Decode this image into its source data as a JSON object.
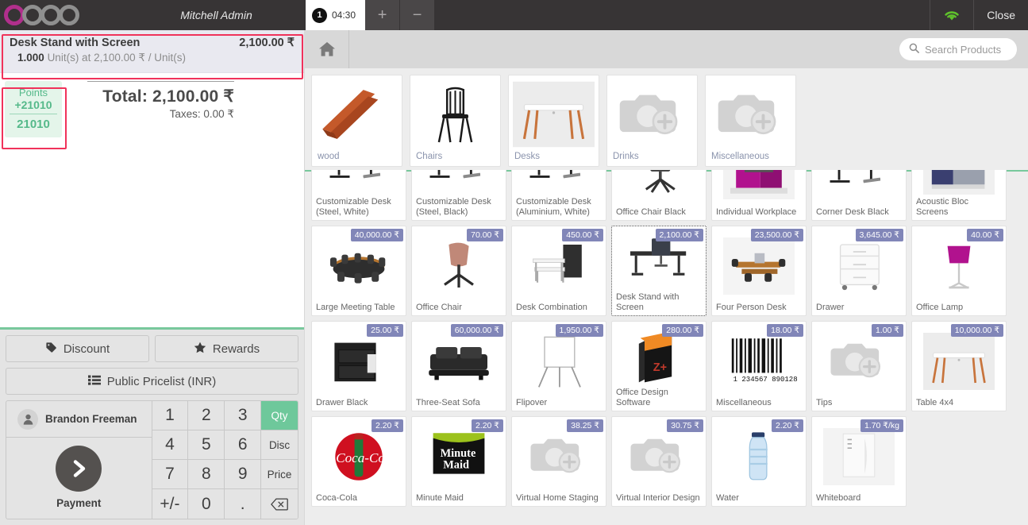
{
  "topbar": {
    "brand": "odoo",
    "user": "Mitchell Admin",
    "order_tab": {
      "sequence": "1",
      "time": "04:30"
    },
    "new_order_label": "+",
    "remove_order_label": "−",
    "wifi_icon": "wifi-icon",
    "close_label": "Close",
    "accent_green": "#7ac143",
    "bar_bg": "#373435"
  },
  "order": {
    "lines": [
      {
        "name": "Desk Stand with Screen",
        "price": "2,100.00 ₹",
        "qty": "1.000",
        "unit_text": "Unit(s) at 2,100.00 ₹ / Unit(s)"
      }
    ],
    "loyalty": {
      "label": "Points",
      "delta": "+21010",
      "total": "21010",
      "color": "#55b98a"
    },
    "total_label": "Total: 2,100.00 ₹",
    "taxes_label": "Taxes: 0.00 ₹"
  },
  "controls": {
    "discount_label": "Discount",
    "rewards_label": "Rewards",
    "pricelist_label": "Public Pricelist (INR)",
    "customer_label": "Brandon Freeman",
    "payment_label": "Payment",
    "numpad": [
      {
        "key": "1",
        "type": "digit"
      },
      {
        "key": "2",
        "type": "digit"
      },
      {
        "key": "3",
        "type": "digit"
      },
      {
        "key": "Qty",
        "type": "mode",
        "active": true
      },
      {
        "key": "4",
        "type": "digit"
      },
      {
        "key": "5",
        "type": "digit"
      },
      {
        "key": "6",
        "type": "digit"
      },
      {
        "key": "Disc",
        "type": "mode",
        "active": false
      },
      {
        "key": "7",
        "type": "digit"
      },
      {
        "key": "8",
        "type": "digit"
      },
      {
        "key": "9",
        "type": "digit"
      },
      {
        "key": "Price",
        "type": "mode",
        "active": false
      },
      {
        "key": "+/-",
        "type": "digit"
      },
      {
        "key": "0",
        "type": "digit"
      },
      {
        "key": ".",
        "type": "digit"
      },
      {
        "key": "backspace",
        "type": "icon"
      }
    ],
    "active_mode_color": "#6ec89b"
  },
  "products_panel": {
    "home_icon": "home-icon",
    "search": {
      "placeholder": "Search Products",
      "icon": "search-icon"
    },
    "categories": [
      {
        "label": "wood",
        "image": "wood-planks"
      },
      {
        "label": "Chairs",
        "image": "black-chair"
      },
      {
        "label": "Desks",
        "image": "white-desk"
      },
      {
        "label": "Drinks",
        "image": "placeholder"
      },
      {
        "label": "Miscellaneous",
        "image": "placeholder"
      }
    ],
    "products": [
      {
        "name": "Customizable Desk (Steel, White)",
        "price": "",
        "image": "desk-legs",
        "selected": false
      },
      {
        "name": "Customizable Desk (Steel, Black)",
        "price": "",
        "image": "desk-legs",
        "selected": false
      },
      {
        "name": "Customizable Desk (Aluminium, White)",
        "price": "",
        "image": "desk-legs",
        "selected": false
      },
      {
        "name": "Office Chair Black",
        "price": "",
        "image": "office-chair-black",
        "selected": false
      },
      {
        "name": "Individual Workplace",
        "price": "",
        "image": "magenta-workplace",
        "selected": false
      },
      {
        "name": "Corner Desk Black",
        "price": "",
        "image": "desk-legs",
        "selected": false
      },
      {
        "name": "Acoustic Bloc Screens",
        "price": "",
        "image": "acoustic-screens",
        "selected": false
      },
      {
        "name": "Large Meeting Table",
        "price": "40,000.00 ₹",
        "image": "meeting-table",
        "selected": false
      },
      {
        "name": "Office Chair",
        "price": "70.00 ₹",
        "image": "office-chair",
        "selected": false
      },
      {
        "name": "Desk Combination",
        "price": "450.00 ₹",
        "image": "desk-combination",
        "selected": false
      },
      {
        "name": "Desk Stand with Screen",
        "price": "2,100.00 ₹",
        "image": "desk-stand-screen",
        "selected": true
      },
      {
        "name": "Four Person Desk",
        "price": "23,500.00 ₹",
        "image": "four-person-desk",
        "selected": false
      },
      {
        "name": "Drawer",
        "price": "3,645.00 ₹",
        "image": "white-drawer",
        "selected": false
      },
      {
        "name": "Office Lamp",
        "price": "40.00 ₹",
        "image": "office-lamp",
        "selected": false
      },
      {
        "name": "Drawer Black",
        "price": "25.00 ₹",
        "image": "drawer-black",
        "selected": false
      },
      {
        "name": "Three-Seat Sofa",
        "price": "60,000.00 ₹",
        "image": "sofa",
        "selected": false
      },
      {
        "name": "Flipover",
        "price": "1,950.00 ₹",
        "image": "flipover",
        "selected": false
      },
      {
        "name": "Office Design Software",
        "price": "280.00 ₹",
        "image": "software-box",
        "selected": false
      },
      {
        "name": "Miscellaneous",
        "price": "18.00 ₹",
        "image": "barcode",
        "selected": false
      },
      {
        "name": "Tips",
        "price": "1.00 ₹",
        "image": "placeholder",
        "selected": false
      },
      {
        "name": "Table 4x4",
        "price": "10,000.00 ₹",
        "image": "white-desk",
        "selected": false
      },
      {
        "name": "Coca-Cola",
        "price": "2.20 ₹",
        "image": "coca-cola",
        "selected": false
      },
      {
        "name": "Minute Maid",
        "price": "2.20 ₹",
        "image": "minute-maid",
        "selected": false
      },
      {
        "name": "Virtual Home Staging",
        "price": "38.25 ₹",
        "image": "placeholder",
        "selected": false
      },
      {
        "name": "Virtual Interior Design",
        "price": "30.75 ₹",
        "image": "placeholder",
        "selected": false
      },
      {
        "name": "Water",
        "price": "2.20 ₹",
        "image": "water-bottle",
        "selected": false
      },
      {
        "name": "Whiteboard",
        "price": "1.70 ₹/kg",
        "image": "whiteboard",
        "selected": false
      }
    ],
    "price_badge_color": "#8186b8",
    "scrollbar_color": "#ee8055"
  }
}
